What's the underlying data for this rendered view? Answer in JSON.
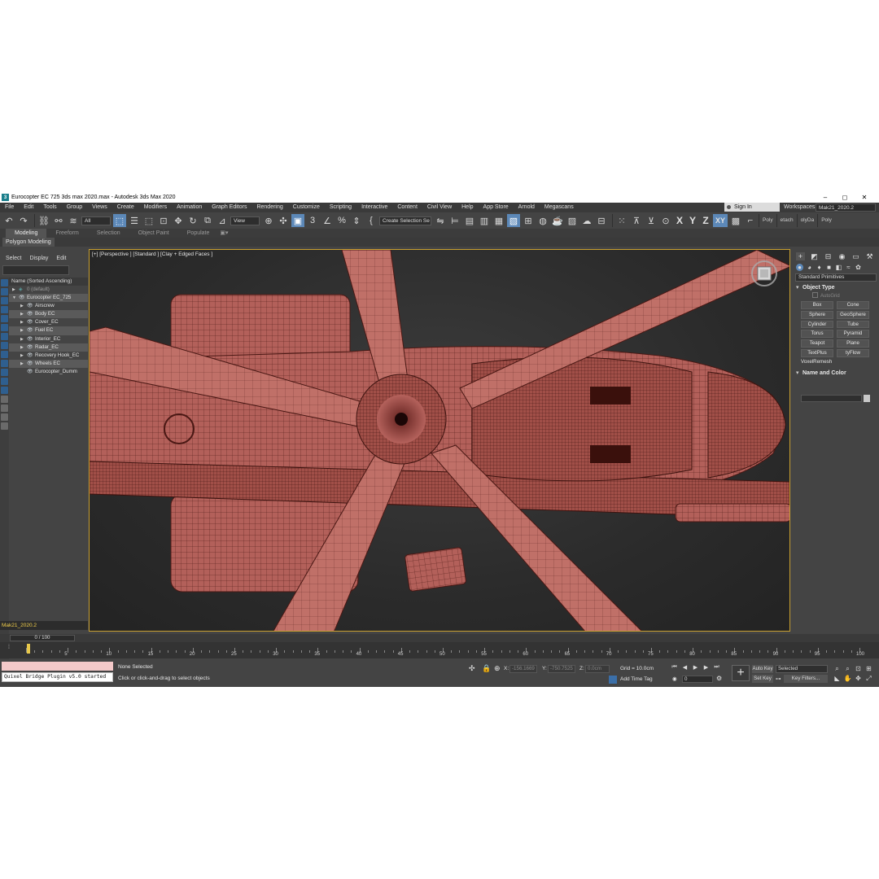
{
  "window": {
    "title": "Eurocopter EC 725 3ds max 2020.max - Autodesk 3ds Max 2020",
    "controls": [
      "–",
      "◻",
      "✕"
    ]
  },
  "menu": {
    "items": [
      "File",
      "Edit",
      "Tools",
      "Group",
      "Views",
      "Create",
      "Modifiers",
      "Animation",
      "Graph Editors",
      "Rendering",
      "Customize",
      "Scripting",
      "Interactive",
      "Content",
      "Civil View",
      "Help",
      "App Store",
      "Arnold",
      "Megascans"
    ],
    "sign_in": "Sign In",
    "workspaces_label": "Workspaces:",
    "workspace_value": "Mak21_2020.2"
  },
  "toolbar": {
    "selection_filter": "All",
    "ref_coord": "View",
    "named_selection": "Create Selection Se",
    "axis_x": "X",
    "axis_y": "Y",
    "axis_z": "Z",
    "axis_xy": "XY",
    "extra_tabs": [
      "Poly",
      "etach",
      "olyDa",
      "Poly"
    ]
  },
  "ribbon": {
    "tabs": [
      "Modeling",
      "Freeform",
      "Selection",
      "Object Paint",
      "Populate"
    ],
    "active": "Modeling",
    "panel": "Polygon Modeling"
  },
  "explorer": {
    "tabs": [
      "Select",
      "Display",
      "Edit"
    ],
    "column_header": "Name (Sorted Ascending)",
    "rows": [
      {
        "label": "0 (default)",
        "level": 0,
        "arrow": "▶",
        "eye": "",
        "dim": true,
        "layer": true
      },
      {
        "label": "Eurocopter EC_725",
        "level": 0,
        "arrow": "▼",
        "eye": "👁",
        "dim": false,
        "selected": true
      },
      {
        "label": "Airscrew",
        "level": 1,
        "arrow": "▶",
        "eye": "👁",
        "dim": false
      },
      {
        "label": "Body EC",
        "level": 1,
        "arrow": "▶",
        "eye": "👁",
        "dim": false,
        "selected": true
      },
      {
        "label": "Cover_EC",
        "level": 1,
        "arrow": "▶",
        "eye": "👁",
        "dim": false
      },
      {
        "label": "Fuel EC",
        "level": 1,
        "arrow": "▶",
        "eye": "👁",
        "dim": false,
        "selected": true
      },
      {
        "label": "Interior_EC",
        "level": 1,
        "arrow": "▶",
        "eye": "👁",
        "dim": false
      },
      {
        "label": "Radar_EC",
        "level": 1,
        "arrow": "▶",
        "eye": "👁",
        "dim": false,
        "selected": true
      },
      {
        "label": "Recovery Hook_EC",
        "level": 1,
        "arrow": "▶",
        "eye": "👁",
        "dim": false
      },
      {
        "label": "Wheels EC",
        "level": 1,
        "arrow": "▶",
        "eye": "👁",
        "dim": false,
        "selected": true
      },
      {
        "label": "Eurocopter_Dumm",
        "level": 1,
        "arrow": "",
        "eye": "👁",
        "dim": false
      }
    ],
    "layer_current": "Mak21_2020.2"
  },
  "viewport": {
    "label": "[+] [Perspective ] [Standard ] [Clay + Edged Faces ]"
  },
  "command_panel": {
    "category": "Standard Primitives",
    "object_type_title": "Object Type",
    "autogrid": "AutoGrid",
    "primitives": [
      "Box",
      "Cone",
      "Sphere",
      "GeoSphere",
      "Cylinder",
      "Tube",
      "Torus",
      "Pyramid",
      "Teapot",
      "Plane",
      "TextPlus",
      "tyFlow"
    ],
    "voxel": "VoxelRemesh",
    "name_color_title": "Name and Color"
  },
  "timeline": {
    "frame_display": "0 / 100",
    "ticks": [
      0,
      5,
      10,
      15,
      20,
      25,
      30,
      35,
      40,
      45,
      50,
      55,
      60,
      65,
      70,
      75,
      80,
      85,
      90,
      95,
      100
    ]
  },
  "status": {
    "maxscript_output": "Quixel Bridge Plugin v5.0 started",
    "selection": "None Selected",
    "prompt": "Click or click-and-drag to select objects",
    "x_label": "X:",
    "x_value": "-156.1669",
    "y_label": "Y:",
    "y_value": "-750.7525",
    "z_label": "Z:",
    "z_value": "0.0cm",
    "grid": "Grid = 10.0cm",
    "add_time_tag": "Add Time Tag",
    "auto_key": "Auto Key",
    "set_key": "Set Key",
    "selected_drop": "Selected",
    "key_filters": "Key Filters...",
    "frame_field": "0"
  },
  "colors": {
    "accent_blue": "#5c88b8",
    "viewport_border": "#c8a030",
    "model_fill": "#b5625c",
    "wire": "#4a1814"
  }
}
